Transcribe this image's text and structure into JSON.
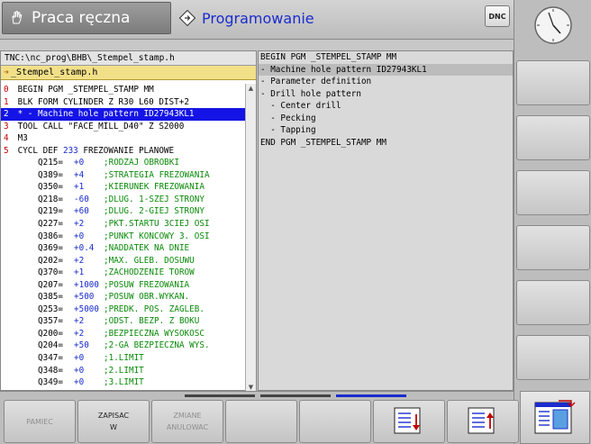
{
  "header": {
    "mode_manual_label": "Praca ręczna",
    "mode_programming_label": "Programowanie",
    "dnc_label": "DNC"
  },
  "program": {
    "path": "TNC:\\nc_prog\\BHB\\_Stempel_stamp.h",
    "file": "_Stempel_stamp.h",
    "lines": [
      {
        "n": "0",
        "t": "BEGIN PGM _STEMPEL_STAMP MM"
      },
      {
        "n": "1",
        "t": "BLK FORM CYLINDER Z R30 L60 DIST+2"
      },
      {
        "n": "2",
        "t": "* - Machine hole pattern ID27943KL1"
      },
      {
        "n": "3",
        "t": "TOOL CALL \"FACE_MILL_D40\" Z S2000"
      },
      {
        "n": "4",
        "t": "M3"
      },
      {
        "n": "5",
        "t1": "CYCL DEF ",
        "t2": "233",
        "t3": " FREZOWANIE PLANOWE"
      }
    ],
    "params": [
      {
        "p": "Q215=",
        "v": "+0",
        "c": ";RODZAJ OBROBKI"
      },
      {
        "p": "Q389=",
        "v": "+4",
        "c": ";STRATEGIA FREZOWANIA"
      },
      {
        "p": "Q350=",
        "v": "+1",
        "c": ";KIERUNEK FREZOWANIA"
      },
      {
        "p": "Q218=",
        "v": "-60",
        "c": ";DLUG. 1-SZEJ STRONY"
      },
      {
        "p": "Q219=",
        "v": "+60",
        "c": ";DLUG. 2-GIEJ STRONY"
      },
      {
        "p": "Q227=",
        "v": "+2",
        "c": ";PKT.STARTU 3CIEJ OSI"
      },
      {
        "p": "Q386=",
        "v": "+0",
        "c": ";PUNKT KONCOWY 3. OSI"
      },
      {
        "p": "Q369=",
        "v": "+0.4",
        "c": ";NADDATEK NA DNIE"
      },
      {
        "p": "Q202=",
        "v": "+2",
        "c": ";MAX. GLEB. DOSUWU"
      },
      {
        "p": "Q370=",
        "v": "+1",
        "c": ";ZACHODZENIE TOROW"
      },
      {
        "p": "Q207=",
        "v": "+1000",
        "c": ";POSUW FREZOWANIA"
      },
      {
        "p": "Q385=",
        "v": "+500",
        "c": ";POSUW OBR.WYKAN."
      },
      {
        "p": "Q253=",
        "v": "+5000",
        "c": ";PREDK. POS. ZAGLEB."
      },
      {
        "p": "Q357=",
        "v": "+2",
        "c": ";ODST. BEZP. Z BOKU"
      },
      {
        "p": "Q200=",
        "v": "+2",
        "c": ";BEZPIECZNA WYSOKOSC"
      },
      {
        "p": "Q204=",
        "v": "+50",
        "c": ";2-GA BEZPIECZNA WYS."
      },
      {
        "p": "Q347=",
        "v": "+0",
        "c": ";1.LIMIT"
      },
      {
        "p": "Q348=",
        "v": "+0",
        "c": ";2.LIMIT"
      },
      {
        "p": "Q349=",
        "v": "+0",
        "c": ";3.LIMIT"
      }
    ]
  },
  "structure": {
    "lines": [
      "BEGIN PGM _STEMPEL_STAMP MM",
      "- Machine hole pattern ID27943KL1",
      "- Parameter definition",
      "- Drill hole pattern",
      "  - Center drill",
      "  - Pecking",
      "  - Tapping",
      "END PGM _STEMPEL_STAMP MM"
    ]
  },
  "softkeys": {
    "pamiec": "PAMIEC",
    "zapisac_1": "ZAPISAC",
    "zapisac_2": "W",
    "zmiane_1": "ZMIANE",
    "zmiane_2": "ANULOWAC"
  },
  "colors": {
    "selection": "#1414e6",
    "keyword_blue": "#1a2ccc",
    "comment_green": "#0a8a0a",
    "line_number_red": "#c00000",
    "filebar_yellow": "#f2e089"
  }
}
